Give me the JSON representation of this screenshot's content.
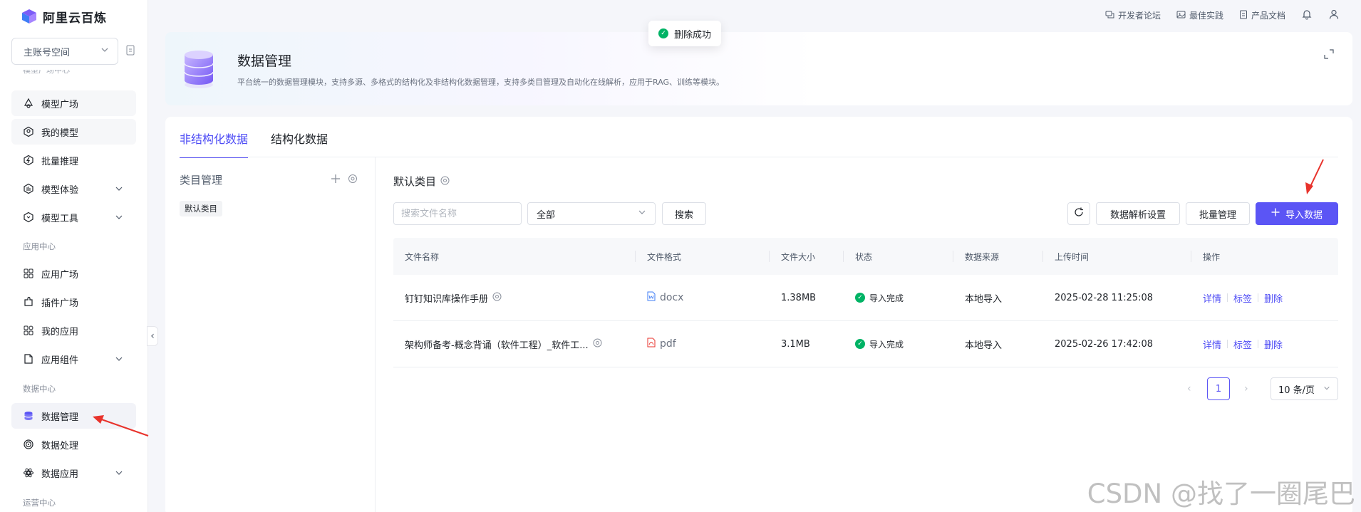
{
  "brand": {
    "name": "阿里云百炼"
  },
  "sidebar": {
    "space_select": "主账号空间",
    "cut_label": "模型广场中心",
    "items": [
      {
        "label": "模型广场",
        "icon": "model-square-icon"
      },
      {
        "label": "我的模型",
        "icon": "my-model-icon"
      },
      {
        "label": "批量推理",
        "icon": "batch-inference-icon"
      },
      {
        "label": "模型体验",
        "icon": "model-experience-icon"
      },
      {
        "label": "模型工具",
        "icon": "model-tools-icon"
      },
      {
        "label": "应用广场",
        "icon": "app-square-icon"
      },
      {
        "label": "插件广场",
        "icon": "plugin-square-icon"
      },
      {
        "label": "我的应用",
        "icon": "my-app-icon"
      },
      {
        "label": "应用组件",
        "icon": "app-component-icon"
      },
      {
        "label": "数据管理",
        "icon": "database-icon"
      },
      {
        "label": "数据处理",
        "icon": "data-processing-icon"
      },
      {
        "label": "数据应用",
        "icon": "data-application-icon"
      }
    ],
    "sections": {
      "app_center": "应用中心",
      "data_center": "数据中心",
      "ops_center": "运营中心"
    }
  },
  "topbar": {
    "forum": "开发者论坛",
    "practice": "最佳实践",
    "docs": "产品文档"
  },
  "toast": {
    "message": "删除成功"
  },
  "header": {
    "title": "数据管理",
    "description": "平台统一的数据管理模块，支持多源、多格式的结构化及非结构化数据管理，支持多类目管理及自动化在线解析，应用于RAG、训练等模块。"
  },
  "tabs": {
    "unstructured": "非结构化数据",
    "structured": "结构化数据"
  },
  "category": {
    "title": "类目管理",
    "default_tag": "默认类目"
  },
  "main": {
    "section_title": "默认类目",
    "search_placeholder": "搜索文件名称",
    "filter_value": "全部",
    "search_button": "搜索",
    "parse_settings_button": "数据解析设置",
    "batch_button": "批量管理",
    "import_button": "导入数据"
  },
  "table": {
    "columns": [
      "文件名称",
      "文件格式",
      "文件大小",
      "状态",
      "数据来源",
      "上传时间",
      "操作"
    ],
    "rows": [
      {
        "name": "钉钉知识库操作手册",
        "format": "docx",
        "size": "1.38MB",
        "status": "导入完成",
        "source": "本地导入",
        "time": "2025-02-28 11:25:08"
      },
      {
        "name": "架构师备考-概念背诵（软件工程）_软件工...",
        "format": "pdf",
        "size": "3.1MB",
        "status": "导入完成",
        "source": "本地导入",
        "time": "2025-02-26 17:42:08"
      }
    ],
    "ops": {
      "detail": "详情",
      "tag": "标签",
      "delete": "删除"
    }
  },
  "pagination": {
    "current": "1",
    "page_size": "10 条/页"
  },
  "watermark": "CSDN @找了一圈尾巴",
  "colors": {
    "accent": "#5b55f5",
    "success": "#00b365",
    "annotation_arrow": "#e8322b"
  }
}
